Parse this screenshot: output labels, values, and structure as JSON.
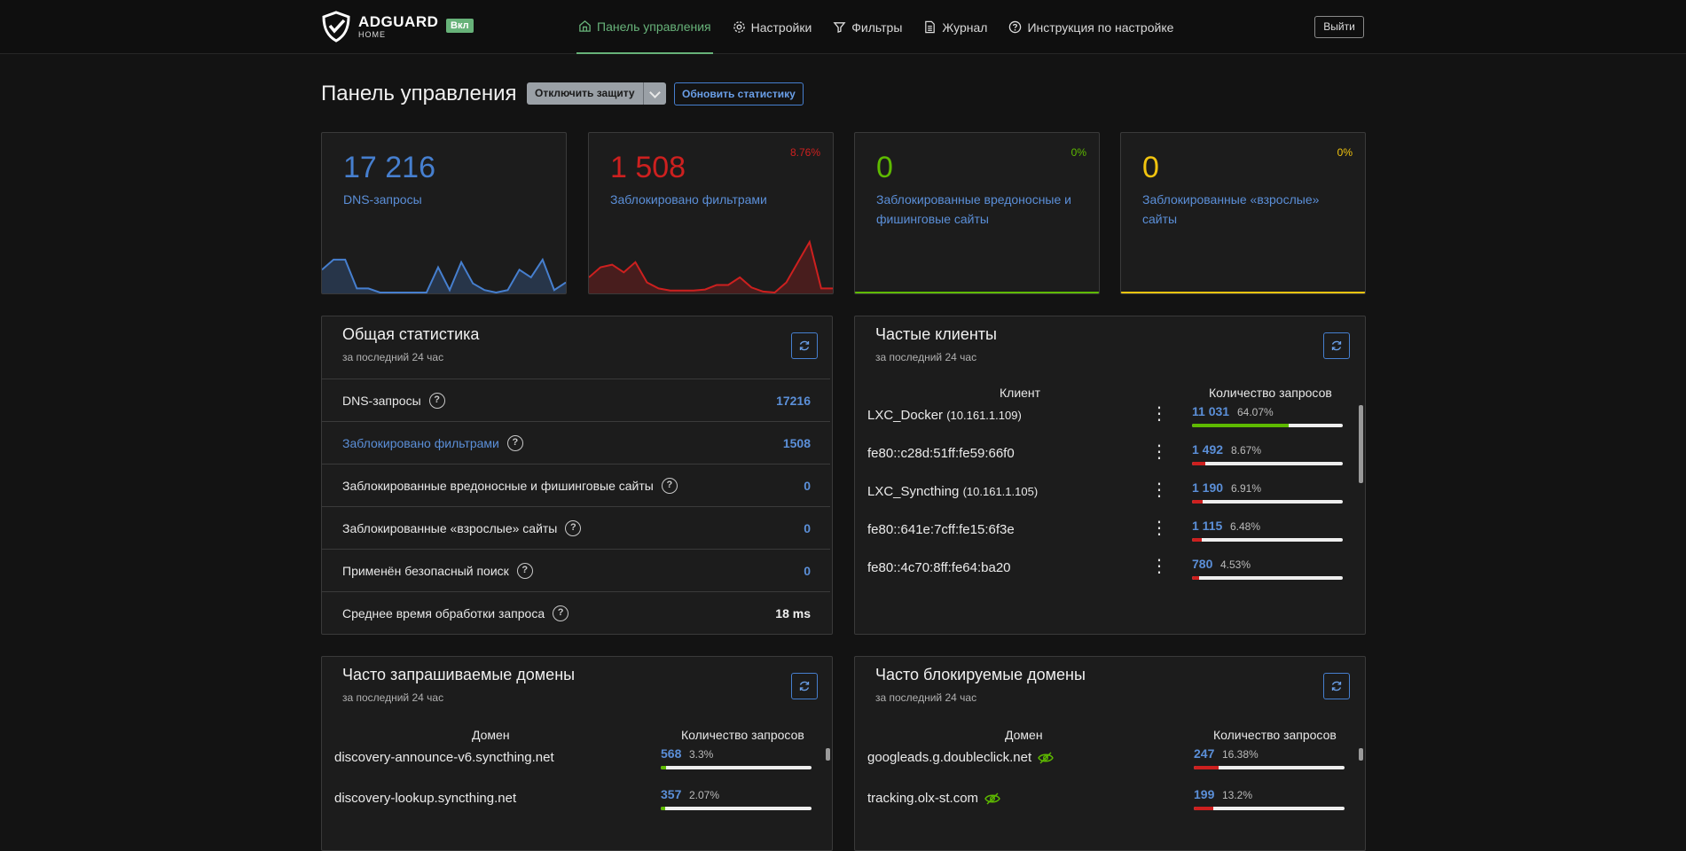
{
  "header": {
    "logo_main": "ADGUARD",
    "logo_sub": "HOME",
    "status_badge": "Вкл",
    "nav": [
      {
        "label": "Панель управления",
        "icon": "home-icon",
        "active": true
      },
      {
        "label": "Настройки",
        "icon": "gear-icon",
        "active": false
      },
      {
        "label": "Фильтры",
        "icon": "filter-icon",
        "active": false
      },
      {
        "label": "Журнал",
        "icon": "document-icon",
        "active": false
      },
      {
        "label": "Инструкция по настройке",
        "icon": "question-circle-icon",
        "active": false
      }
    ],
    "logout_label": "Выйти"
  },
  "toolbar": {
    "title": "Панель управления",
    "disable_protection": "Отключить защиту",
    "refresh_stats": "Обновить статистику"
  },
  "cards": [
    {
      "value": "17 216",
      "label": "DNS-запросы",
      "percent": "",
      "color": "#467fcf",
      "series": [
        0.45,
        0.65,
        0.65,
        0.08,
        0.08,
        0,
        0,
        0,
        0,
        0,
        0.5,
        0.05,
        0.6,
        0.18,
        0.05,
        0,
        0.05,
        0.45,
        0.3,
        0.65,
        0.05,
        0.2
      ]
    },
    {
      "value": "1 508",
      "label": "Заблокировано фильтрами",
      "percent": "8.76%",
      "color": "#cd201f",
      "series": [
        0.3,
        0.5,
        0.55,
        0.4,
        0.6,
        0.2,
        0.08,
        0.04,
        0.04,
        0.04,
        0.06,
        0.15,
        0.15,
        0.3,
        0.1,
        0.02,
        0,
        0.2,
        0.6,
        1.0,
        0.08,
        0.08
      ]
    },
    {
      "value": "0",
      "label": "Заблокированные вредоносные и фишинговые сайты",
      "percent": "0%",
      "color": "#5eba00"
    },
    {
      "value": "0",
      "label": "Заблокированные «взрослые» сайты",
      "percent": "0%",
      "color": "#f1c40f"
    }
  ],
  "general_stats": {
    "title": "Общая статистика",
    "subtitle": "за последний 24 час",
    "rows": [
      {
        "label": "DNS-запросы",
        "value": "17216"
      },
      {
        "label": "Заблокировано фильтрами",
        "value": "1508"
      },
      {
        "label": "Заблокированные вредоносные и фишинговые сайты",
        "value": "0"
      },
      {
        "label": "Заблокированные «взрослые» сайты",
        "value": "0"
      },
      {
        "label": "Применён безопасный поиск",
        "value": "0"
      },
      {
        "label": "Среднее время обработки запроса",
        "value": "18 ms"
      }
    ]
  },
  "top_clients": {
    "title": "Частые клиенты",
    "subtitle": "за последний 24 час",
    "col_client": "Клиент",
    "col_count": "Количество запросов",
    "rows": [
      {
        "name": "LXC_Docker",
        "ip": "(10.161.1.109)",
        "count": "11 031",
        "percent": "64.07%",
        "ratio": 0.6407,
        "bar_color": "#5eba00"
      },
      {
        "name": "fe80::c28d:51ff:fe59:66f0",
        "ip": "",
        "count": "1 492",
        "percent": "8.67%",
        "ratio": 0.0867,
        "bar_color": "#cd201f"
      },
      {
        "name": "LXC_Syncthing",
        "ip": "(10.161.1.105)",
        "count": "1 190",
        "percent": "6.91%",
        "ratio": 0.0691,
        "bar_color": "#cd201f"
      },
      {
        "name": "fe80::641e:7cff:fe15:6f3e",
        "ip": "",
        "count": "1 115",
        "percent": "6.48%",
        "ratio": 0.0648,
        "bar_color": "#cd201f"
      },
      {
        "name": "fe80::4c70:8ff:fe64:ba20",
        "ip": "",
        "count": "780",
        "percent": "4.53%",
        "ratio": 0.0453,
        "bar_color": "#cd201f"
      }
    ]
  },
  "top_domains": {
    "title": "Часто запрашиваемые домены",
    "subtitle": "за последний 24 час",
    "col_domain": "Домен",
    "col_count": "Количество запросов",
    "rows": [
      {
        "name": "discovery-announce-v6.syncthing.net",
        "count": "568",
        "percent": "3.3%",
        "ratio": 0.033,
        "bar_color": "#5eba00"
      },
      {
        "name": "discovery-lookup.syncthing.net",
        "count": "357",
        "percent": "2.07%",
        "ratio": 0.0207,
        "bar_color": "#5eba00"
      }
    ]
  },
  "top_blocked": {
    "title": "Часто блокируемые домены",
    "subtitle": "за последний 24 час",
    "col_domain": "Домен",
    "col_count": "Количество запросов",
    "rows": [
      {
        "name": "googleads.g.doubleclick.net",
        "count": "247",
        "percent": "16.38%",
        "ratio": 0.1638,
        "bar_color": "#cd201f"
      },
      {
        "name": "tracking.olx-st.com",
        "count": "199",
        "percent": "13.2%",
        "ratio": 0.132,
        "bar_color": "#cd201f"
      }
    ]
  },
  "colors": {
    "accent_green": "#67b279",
    "link_blue": "#5b8fd8",
    "blocked_red": "#cd201f",
    "safe_green": "#5eba00",
    "adult_yellow": "#f1c40f"
  }
}
